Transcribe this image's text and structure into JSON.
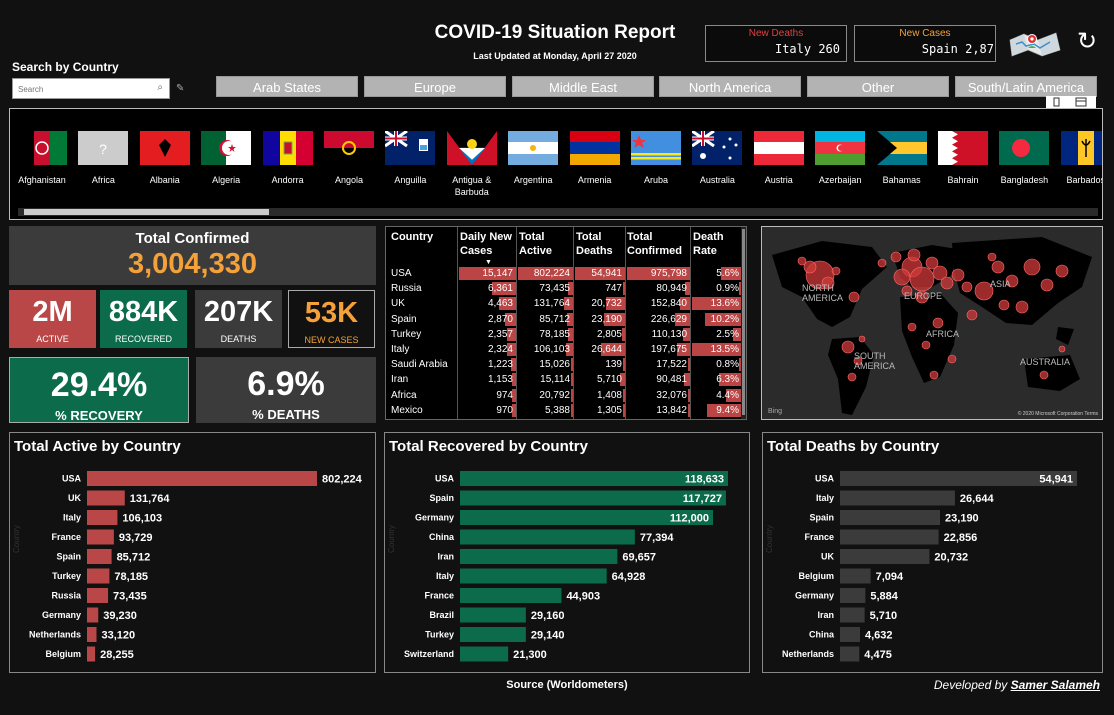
{
  "header": {
    "title": "COVID-19 Situation Report",
    "updated": "Last Updated at Monday, April 27 2020"
  },
  "tickers": {
    "deaths": {
      "label": "New Deaths",
      "value": "Italy 260",
      "color": "#e04040"
    },
    "cases": {
      "label": "New Cases",
      "value": "Spain 2,87",
      "color": "#f4a13a"
    }
  },
  "search": {
    "label": "Search by Country",
    "placeholder": "Search"
  },
  "regions": [
    "Arab States",
    "Europe",
    "Middle East",
    "North America",
    "Other",
    "South/Latin America"
  ],
  "flags": [
    "Afghanistan",
    "Africa",
    "Albania",
    "Algeria",
    "Andorra",
    "Angola",
    "Anguilla",
    "Antigua &\nBarbuda",
    "Argentina",
    "Armenia",
    "Aruba",
    "Australia",
    "Austria",
    "Azerbaijan",
    "Bahamas",
    "Bahrain",
    "Bangladesh",
    "Barbados"
  ],
  "kpi": {
    "total_label": "Total Confirmed",
    "total_value": "3,004,330",
    "active": {
      "value": "2M",
      "label": "ACTIVE",
      "color": "#b94747"
    },
    "recovered": {
      "value": "884K",
      "label": "RECOVERED",
      "color": "#0b6b4a"
    },
    "deaths": {
      "value": "207K",
      "label": "DEATHS",
      "color": "#3b3b3b"
    },
    "new_cases": {
      "value": "53K",
      "label": "NEW CASES",
      "color": "#f4a13a"
    },
    "recovery": {
      "value": "29.4%",
      "label": "% RECOVERY"
    },
    "death_pct": {
      "value": "6.9%",
      "label": "% DEATHS"
    }
  },
  "table": {
    "headers": [
      "Country",
      "Daily New Cases",
      "Total Active",
      "Total Deaths",
      "Total Confirmed",
      "Death Rate"
    ],
    "rows": [
      [
        "USA",
        "15,147",
        "802,224",
        "54,941",
        "975,798",
        "5.6%"
      ],
      [
        "Russia",
        "6,361",
        "73,435",
        "747",
        "80,949",
        "0.9%"
      ],
      [
        "UK",
        "4,463",
        "131,764",
        "20,732",
        "152,840",
        "13.6%"
      ],
      [
        "Spain",
        "2,870",
        "85,712",
        "23,190",
        "226,629",
        "10.2%"
      ],
      [
        "Turkey",
        "2,357",
        "78,185",
        "2,805",
        "110,130",
        "2.5%"
      ],
      [
        "Italy",
        "2,324",
        "106,103",
        "26,644",
        "197,675",
        "13.5%"
      ],
      [
        "Saudi Arabia",
        "1,223",
        "15,026",
        "139",
        "17,522",
        "0.8%"
      ],
      [
        "Iran",
        "1,153",
        "15,114",
        "5,710",
        "90,481",
        "6.3%"
      ],
      [
        "Africa",
        "974",
        "20,792",
        "1,408",
        "32,076",
        "4.4%"
      ],
      [
        "Mexico",
        "970",
        "5,388",
        "1,305",
        "13,842",
        "9.4%"
      ]
    ]
  },
  "map": {
    "labels": [
      "NORTH AMERICA",
      "EUROPE",
      "ASIA",
      "AFRICA",
      "SOUTH AMERICA",
      "AUSTRALIA"
    ],
    "credit": "© 2020 Microsoft Corporation  Terms",
    "brand": "Bing"
  },
  "chart_data": [
    {
      "type": "bar",
      "title": "Total Active by Country",
      "ylabel": "Country",
      "categories": [
        "USA",
        "UK",
        "Italy",
        "France",
        "Spain",
        "Turkey",
        "Russia",
        "Germany",
        "Netherlands",
        "Belgium"
      ],
      "values": [
        802224,
        131764,
        106103,
        93729,
        85712,
        78185,
        73435,
        39230,
        33120,
        28255
      ],
      "labels": [
        "802,224",
        "131,764",
        "106,103",
        "93,729",
        "85,712",
        "78,185",
        "73,435",
        "39,230",
        "33,120",
        "28,255"
      ],
      "color": "#b94747"
    },
    {
      "type": "bar",
      "title": "Total Recovered by Country",
      "ylabel": "Country",
      "categories": [
        "USA",
        "Spain",
        "Germany",
        "China",
        "Iran",
        "Italy",
        "France",
        "Brazil",
        "Turkey",
        "Switzerland"
      ],
      "values": [
        118633,
        117727,
        112000,
        77394,
        69657,
        64928,
        44903,
        29160,
        29140,
        21300
      ],
      "labels": [
        "118,633",
        "117,727",
        "112,000",
        "77,394",
        "69,657",
        "64,928",
        "44,903",
        "29,160",
        "29,140",
        "21,300"
      ],
      "color": "#0b6b4a"
    },
    {
      "type": "bar",
      "title": "Total Deaths by Country",
      "ylabel": "Country",
      "categories": [
        "USA",
        "Italy",
        "Spain",
        "France",
        "UK",
        "Belgium",
        "Germany",
        "Iran",
        "China",
        "Netherlands"
      ],
      "values": [
        54941,
        26644,
        23190,
        22856,
        20732,
        7094,
        5884,
        5710,
        4632,
        4475
      ],
      "labels": [
        "54,941",
        "26,644",
        "23,190",
        "22,856",
        "20,732",
        "7,094",
        "5,884",
        "5,710",
        "4,632",
        "4,475"
      ],
      "color": "#3b3b3b"
    }
  ],
  "footer": {
    "source": "Source (Worldometers)",
    "dev_prefix": "Developed by",
    "dev_name": "Samer Salameh"
  }
}
